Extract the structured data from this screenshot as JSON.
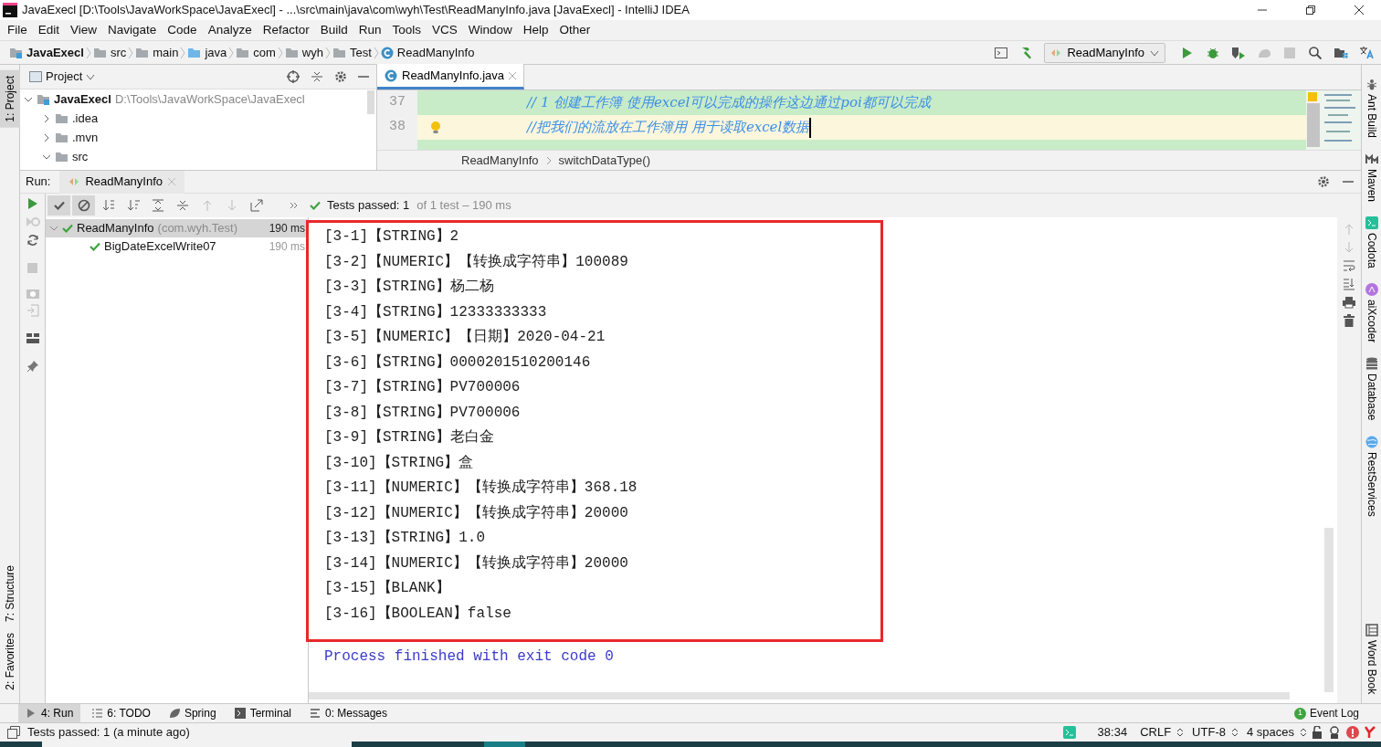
{
  "window": {
    "title": "JavaExecl [D:\\Tools\\JavaWorkSpace\\JavaExecl] - ...\\src\\main\\java\\com\\wyh\\Test\\ReadManyInfo.java [JavaExecl] - IntelliJ IDEA"
  },
  "menu": [
    "File",
    "Edit",
    "View",
    "Navigate",
    "Code",
    "Analyze",
    "Refactor",
    "Build",
    "Run",
    "Tools",
    "VCS",
    "Window",
    "Help",
    "Other"
  ],
  "nav_path": [
    "JavaExecl",
    "src",
    "main",
    "java",
    "com",
    "wyh",
    "Test",
    "ReadManyInfo"
  ],
  "toolbar": {
    "run_config": "ReadManyInfo"
  },
  "left_stripe": [
    {
      "label": "1: Project",
      "selected": true
    },
    {
      "label": "7: Structure",
      "selected": false
    },
    {
      "label": "2: Favorites",
      "selected": false
    }
  ],
  "project_panel": {
    "title": "Project",
    "tree": [
      {
        "label": "JavaExecl",
        "path": "D:\\Tools\\JavaWorkSpace\\JavaExecl",
        "expanded": true,
        "children": [
          {
            "label": ".idea",
            "expanded": false
          },
          {
            "label": ".mvn",
            "expanded": false
          },
          {
            "label": "src",
            "expanded": true
          }
        ]
      }
    ]
  },
  "editor": {
    "tab": "ReadManyInfo.java",
    "lines": [
      {
        "number": "37",
        "text": "// 1 创建工作簿 使用excel可以完成的操作这边通过poi都可以完成",
        "current": false
      },
      {
        "number": "38",
        "text": "//把我们的流放在工作簿用 用于读取excel数据",
        "current": true
      }
    ],
    "breadcrumb": [
      "ReadManyInfo",
      "switchDataType()"
    ]
  },
  "run_panel": {
    "label": "Run:",
    "tab": "ReadManyInfo",
    "status": "Tests passed: 1",
    "status_detail": "of 1 test – 190 ms",
    "tests": [
      {
        "name": "ReadManyInfo",
        "package": "(com.wyh.Test)",
        "time": "190 ms",
        "selected": true,
        "children": [
          {
            "name": "BigDateExcelWrite07",
            "time": "190 ms",
            "selected": false
          }
        ]
      }
    ],
    "console": [
      "[3-1]【STRING】2",
      "[3-2]【NUMERIC】【转换成字符串】100089",
      "[3-3]【STRING】杨二杨",
      "[3-4]【STRING】12333333333",
      "[3-5]【NUMERIC】【日期】2020-04-21",
      "[3-6]【STRING】0000201510200146",
      "[3-7]【STRING】PV700006",
      "[3-8]【STRING】PV700006",
      "[3-9]【STRING】老白金",
      "[3-10]【STRING】盒",
      "[3-11]【NUMERIC】【转换成字符串】368.18",
      "[3-12]【NUMERIC】【转换成字符串】20000",
      "[3-13]【STRING】1.0",
      "[3-14]【NUMERIC】【转换成字符串】20000",
      "[3-15]【BLANK】",
      "[3-16]【BOOLEAN】false"
    ],
    "exit_message": "Process finished with exit code 0"
  },
  "right_stripe": [
    "Ant Build",
    "Maven",
    "Codota",
    "aiXcoder",
    "Database",
    "RestServices",
    "Word Book"
  ],
  "bottom_tabs": [
    {
      "label": "4: Run",
      "selected": true
    },
    {
      "label": "6: TODO",
      "selected": false
    },
    {
      "label": "Spring",
      "selected": false
    },
    {
      "label": "Terminal",
      "selected": false
    },
    {
      "label": "0: Messages",
      "selected": false
    }
  ],
  "event_log": {
    "label": "Event Log",
    "count": "1"
  },
  "status_bar": {
    "message": "Tests passed: 1 (a minute ago)",
    "position": "38:34",
    "line_ending": "CRLF",
    "encoding": "UTF-8",
    "indent": "4 spaces"
  }
}
